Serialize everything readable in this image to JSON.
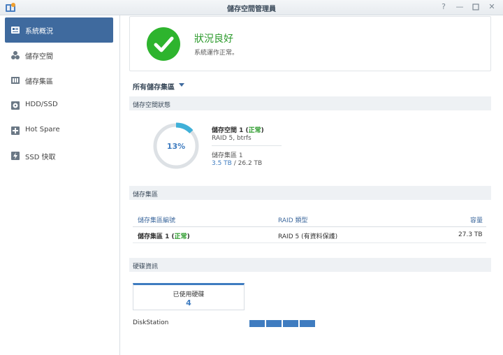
{
  "window": {
    "title": "儲存空間管理員"
  },
  "sidebar": {
    "items": [
      {
        "label": "系統概況",
        "icon": "overview-icon"
      },
      {
        "label": "儲存空間",
        "icon": "volume-icon"
      },
      {
        "label": "儲存集區",
        "icon": "storage-pool-icon"
      },
      {
        "label": "HDD/SSD",
        "icon": "hdd-icon"
      },
      {
        "label": "Hot Spare",
        "icon": "hot-spare-icon"
      },
      {
        "label": "SSD 快取",
        "icon": "ssd-cache-icon"
      }
    ]
  },
  "status": {
    "title": "狀況良好",
    "subtitle": "系統運作正常。"
  },
  "pool_selector": {
    "value": "所有儲存集區"
  },
  "volume_section": {
    "title": "儲存空間狀態",
    "usage_percent_label": "13%",
    "usage_percent": 13,
    "volume_name": "儲存空間 1",
    "volume_status": "正常",
    "volume_raid": "RAID 5, btrfs",
    "pool_name": "儲存集區 1",
    "pool_used": "3.5 TB",
    "pool_total": "26.2 TB"
  },
  "pool_section": {
    "title": "儲存集區",
    "headers": {
      "name": "儲存集區編號",
      "raid": "RAID 類型",
      "capacity": "容量"
    },
    "rows": [
      {
        "name": "儲存集區 1",
        "status": "正常",
        "raid": "RAID 5 (有資料保護)",
        "capacity": "27.3 TB"
      }
    ]
  },
  "disk_section": {
    "title": "硬碟資訊",
    "used_label": "已使用硬碟",
    "used_count": "4",
    "device": "DiskStation",
    "slots": 4
  },
  "colors": {
    "accent": "#3f6a9e",
    "ok": "#2b9a2b",
    "disk": "#3f7cc0"
  }
}
